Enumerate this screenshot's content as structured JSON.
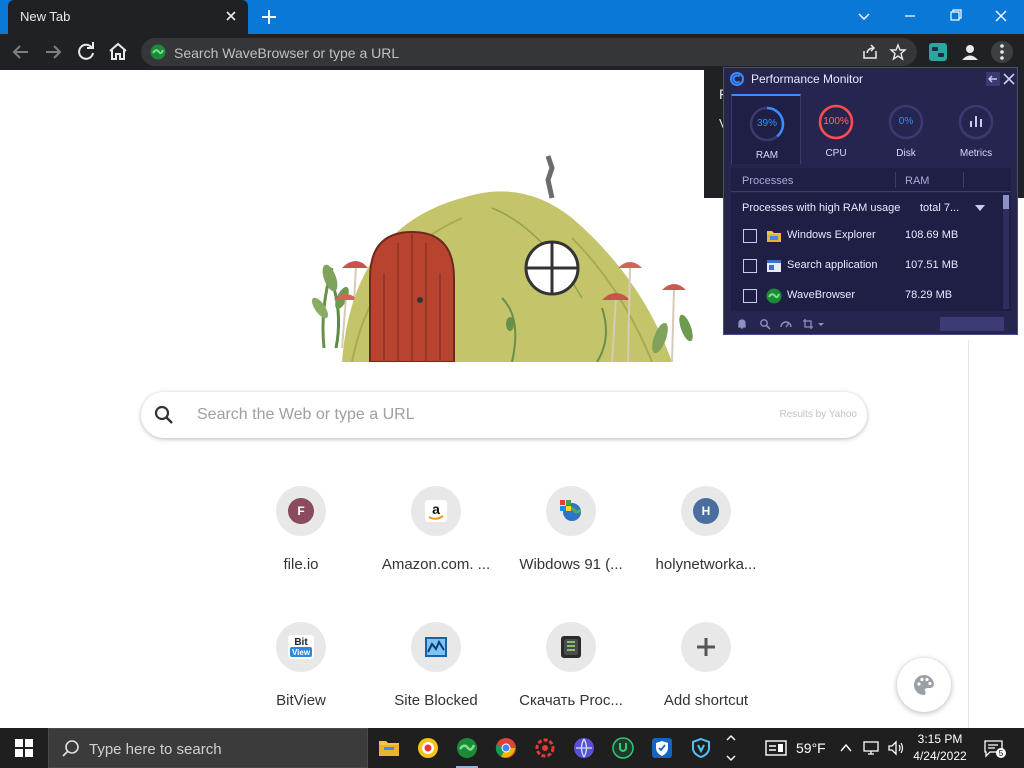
{
  "browser": {
    "tab_title": "New Tab",
    "omnibox_placeholder": "Search WaveBrowser or type a URL"
  },
  "notice": {
    "line1": "F",
    "line2": "V"
  },
  "search": {
    "placeholder": "Search the Web or type a URL",
    "powered_by": "Results by Yahoo"
  },
  "shortcuts": [
    {
      "label": "file.io",
      "icon": "letter-f-icon",
      "letter": "F",
      "color": "#8a4b5c"
    },
    {
      "label": "Amazon.com. ...",
      "icon": "amazon-icon"
    },
    {
      "label": "Wibdows 91 (...",
      "icon": "windows-globe-icon"
    },
    {
      "label": "holynetworka...",
      "icon": "letter-h-icon",
      "letter": "H",
      "color": "#4a6f9e"
    },
    {
      "label": "BitView",
      "icon": "bitview-icon",
      "logo_text_1": "Bit",
      "logo_text_2": "View"
    },
    {
      "label": "Site Blocked",
      "icon": "site-blocked-icon"
    },
    {
      "label": "Скачать Proc...",
      "icon": "process-app-icon"
    },
    {
      "label": "Add shortcut",
      "icon": "plus-icon"
    }
  ],
  "perf_monitor": {
    "title": "Performance Monitor",
    "tabs": [
      {
        "label": "RAM",
        "value": "39%",
        "percent": 39,
        "color": "#3b8cff"
      },
      {
        "label": "CPU",
        "value": "100%",
        "percent": 100,
        "color": "#ff4d4d"
      },
      {
        "label": "Disk",
        "value": "0%",
        "percent": 0,
        "color": "#3b8cff"
      },
      {
        "label": "Metrics",
        "icon": "bar-chart-icon"
      }
    ],
    "columns": {
      "processes": "Processes",
      "ram": "RAM"
    },
    "group_label": "Processes with high RAM usage",
    "group_total": "total 7...",
    "processes": [
      {
        "name": "Windows Explorer",
        "ram": "108.69 MB",
        "icon": "folder-icon"
      },
      {
        "name": "Search application",
        "ram": "107.51 MB",
        "icon": "search-app-icon"
      },
      {
        "name": "WaveBrowser",
        "ram": "78.29 MB",
        "icon": "wavebrowser-icon"
      }
    ]
  },
  "taskbar": {
    "search_placeholder": "Type here to search",
    "weather": "59°F",
    "time": "3:15 PM",
    "date": "4/24/2022",
    "notification_count": "5"
  },
  "colors": {
    "titlebar": "#0a78d7",
    "toolbar": "#202124",
    "accent_ram": "#3b8cff",
    "accent_cpu": "#ff4d4d",
    "monitor_bg": "#26254f"
  }
}
